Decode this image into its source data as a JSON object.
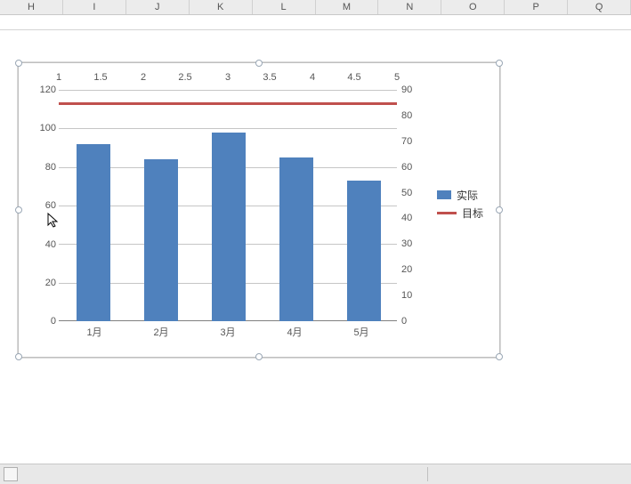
{
  "columns": [
    "H",
    "I",
    "J",
    "K",
    "L",
    "M",
    "N",
    "O",
    "P",
    "Q"
  ],
  "legend": {
    "series_bar": "实际",
    "series_line": "目标"
  },
  "chart_data": {
    "type": "bar",
    "categories": [
      "1月",
      "2月",
      "3月",
      "4月",
      "5月"
    ],
    "series": [
      {
        "name": "实际",
        "type": "bar",
        "yaxis": "left",
        "values": [
          92,
          84,
          98,
          85,
          73
        ]
      },
      {
        "name": "目标",
        "type": "line",
        "yaxis": "right",
        "values": [
          85,
          85,
          85,
          85,
          85
        ]
      }
    ],
    "left_axis": {
      "min": 0,
      "max": 120,
      "step": 20
    },
    "right_axis": {
      "min": 0,
      "max": 90,
      "step": 10
    },
    "top_axis": {
      "min": 1,
      "max": 5,
      "step": 0.5
    },
    "colors": {
      "bar": "#4F81BD",
      "line": "#C0504D"
    }
  },
  "left_ticks": [
    "0",
    "20",
    "40",
    "60",
    "80",
    "100",
    "120"
  ],
  "right_ticks": [
    "0",
    "10",
    "20",
    "30",
    "40",
    "50",
    "60",
    "70",
    "80",
    "90"
  ],
  "top_ticks": [
    "1",
    "1.5",
    "2",
    "2.5",
    "3",
    "3.5",
    "4",
    "4.5",
    "5"
  ],
  "bottom_ticks": [
    "1月",
    "2月",
    "3月",
    "4月",
    "5月"
  ]
}
